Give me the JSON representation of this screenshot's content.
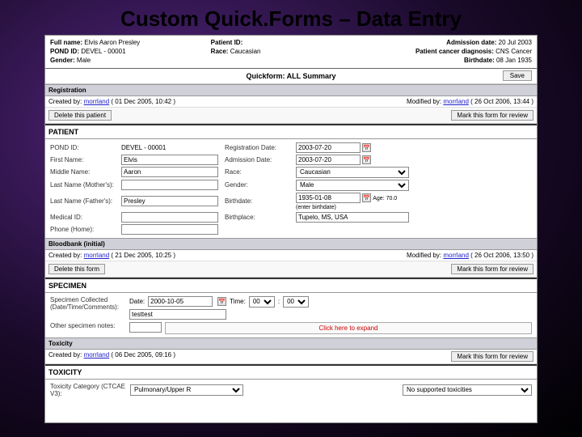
{
  "slide_title": "Custom Quick.Forms – Data Entry",
  "header": {
    "full_name_label": "Full name:",
    "full_name": "Elvis Aaron Presley",
    "pond_id_label": "POND ID:",
    "pond_id": "DEVEL - 00001",
    "gender_label": "Gender:",
    "gender": "Male",
    "patient_id_label": "Patient ID:",
    "patient_id": "",
    "race_label": "Race:",
    "race": "Caucasian",
    "admission_date_label": "Admission date:",
    "admission_date": "20 Jul 2003",
    "diagnosis_label": "Patient cancer diagnosis:",
    "diagnosis": "CNS Cancer",
    "birthdate_label": "Birthdate:",
    "birthdate": "08 Jan 1935"
  },
  "quickform_title": "Quickform: ALL Summary",
  "save_label": "Save",
  "sections": {
    "registration": {
      "title": "Registration",
      "created_label": "Created by:",
      "created_user": "morrland",
      "created_at": "( 01 Dec 2005, 10:42 )",
      "modified_label": "Modified by:",
      "modified_user": "morrland",
      "modified_at": "( 26 Oct 2006, 13:44 )",
      "delete_btn": "Delete this patient",
      "mark_btn": "Mark this form for review"
    },
    "patient": {
      "title": "PATIENT",
      "fields": {
        "pond_id_label": "POND ID:",
        "pond_id": "DEVEL - 00001",
        "reg_date_label": "Registration Date:",
        "reg_date": "2003-07-20",
        "first_name_label": "First Name:",
        "first_name": "Elvis",
        "admission_date_label": "Admission Date:",
        "admission_date": "2003-07-20",
        "middle_name_label": "Middle Name:",
        "middle_name": "Aaron",
        "race_label": "Race:",
        "race": "Caucasian",
        "last_name_m_label": "Last Name (Mother's):",
        "last_name_m": "",
        "gender_label": "Gender:",
        "gender": "Male",
        "last_name_f_label": "Last Name (Father's):",
        "last_name_f": "Presley",
        "birthdate_label": "Birthdate:",
        "birthdate": "1935-01-08",
        "age_label": "Age: 70.0 (enter birthdate)",
        "medical_id_label": "Medical ID:",
        "medical_id": "",
        "birthplace_label": "Birthplace:",
        "birthplace": "Tupelo, MS, USA",
        "phone_label": "Phone (Home):",
        "phone": ""
      }
    },
    "bloodbank": {
      "title": "Bloodbank (initial)",
      "created_label": "Created by:",
      "created_user": "morrland",
      "created_at": "( 21 Dec 2005, 10:25 )",
      "modified_label": "Modified by:",
      "modified_user": "morrland",
      "modified_at": "( 26 Oct 2006, 13:50 )",
      "delete_btn": "Delete this form",
      "mark_btn": "Mark this form for review"
    },
    "specimen": {
      "title": "SPECIMEN",
      "collected_label": "Specimen Collected (Date/Time/Comments):",
      "date_label": "Date:",
      "date": "2000-10-05",
      "time_label": "Time:",
      "hour": "00",
      "minute": "00",
      "comment": "testtest",
      "other_label": "Other specimen notes:",
      "expand": "Click here to expand"
    },
    "toxicity_hdr": {
      "title": "Toxicity",
      "created_label": "Created by:",
      "created_user": "morrland",
      "created_at": "( 06 Dec 2005, 09:16 )",
      "mark_btn": "Mark this form for review"
    },
    "toxicity": {
      "title": "TOXICITY",
      "category_label": "Toxicity Category (CTCAE V3):",
      "category": "Pulmonary/Upper R",
      "select_default": "No supported toxicities"
    }
  }
}
